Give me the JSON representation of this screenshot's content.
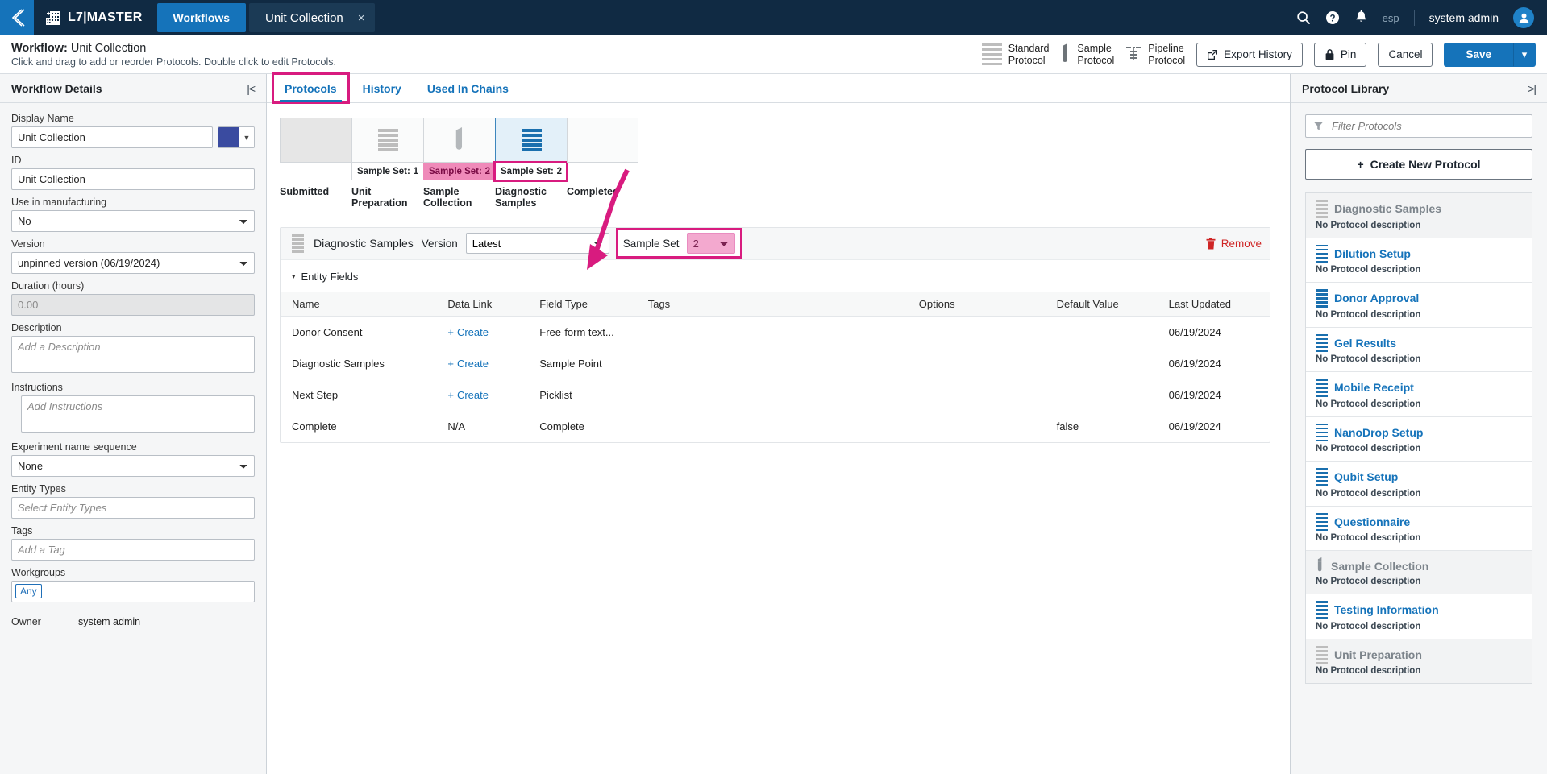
{
  "topnav": {
    "back_icon": "chevron-left-icon",
    "brand_icon": "building-icon",
    "brand": "L7|MASTER",
    "workflows_tab": "Workflows",
    "doc_tab": "Unit Collection",
    "close_glyph": "×",
    "search_icon": "search-icon",
    "help_icon": "help-circle-icon",
    "bell_icon": "bell-icon",
    "lang": "esp",
    "user": "system admin",
    "avatar_icon": "user-avatar-icon",
    "accent": "#1573ba",
    "bg": "#102a43"
  },
  "pagehead": {
    "title_prefix": "Workflow:",
    "title_value": "Unit Collection",
    "subtitle": "Click and drag to add or reorder Protocols. Double click to edit Protocols.",
    "protocol_types": [
      {
        "icon": "standard-protocol-icon",
        "line1": "Standard",
        "line2": "Protocol"
      },
      {
        "icon": "sample-protocol-icon",
        "line1": "Sample",
        "line2": "Protocol"
      },
      {
        "icon": "pipeline-protocol-icon",
        "line1": "Pipeline",
        "line2": "Protocol"
      }
    ],
    "export_history": "Export History",
    "pin": "Pin",
    "cancel": "Cancel",
    "save": "Save",
    "save_caret": "▾"
  },
  "left": {
    "header": "Workflow Details",
    "collapse_icon": "collapse-left-icon",
    "display_name_label": "Display Name",
    "display_name_value": "Unit Collection",
    "color_value": "#3a4ba0",
    "id_label": "ID",
    "id_value": "Unit Collection",
    "manufacturing_label": "Use in manufacturing",
    "manufacturing_value": "No",
    "version_label": "Version",
    "version_value": "unpinned version (06/19/2024)",
    "duration_label": "Duration (hours)",
    "duration_value": "0.00",
    "description_label": "Description",
    "description_placeholder": "Add a Description",
    "instructions_label": "Instructions",
    "instructions_placeholder": "Add Instructions",
    "experiment_seq_label": "Experiment name sequence",
    "experiment_seq_value": "None",
    "entity_types_label": "Entity Types",
    "entity_types_placeholder": "Select Entity Types",
    "tags_label": "Tags",
    "tags_placeholder": "Add a Tag",
    "workgroups_label": "Workgroups",
    "workgroups_chip": "Any",
    "owner_label": "Owner",
    "owner_value": "system admin"
  },
  "center": {
    "tabs": [
      {
        "label": "Protocols",
        "active": true,
        "highlighted": true
      },
      {
        "label": "History",
        "active": false,
        "highlighted": false
      },
      {
        "label": "Used In Chains",
        "active": false,
        "highlighted": false
      }
    ],
    "steps": [
      {
        "name": "Submitted",
        "icon": "none",
        "sampleset_label": "",
        "sampleset_value": "",
        "state": "start"
      },
      {
        "name": "Unit Preparation",
        "icon": "standard-protocol-icon",
        "sampleset_label": "Sample Set:",
        "sampleset_value": "1",
        "state": "normal"
      },
      {
        "name": "Sample Collection",
        "icon": "sample-protocol-icon",
        "sampleset_label": "Sample Set:",
        "sampleset_value": "2",
        "state": "pink"
      },
      {
        "name": "Diagnostic Samples",
        "icon": "standard-protocol-icon",
        "sampleset_label": "Sample Set:",
        "sampleset_value": "2",
        "state": "selected"
      },
      {
        "name": "Completed",
        "icon": "none",
        "sampleset_label": "",
        "sampleset_value": "",
        "state": "end"
      }
    ],
    "detail": {
      "icon": "standard-protocol-icon",
      "protocol_name": "Diagnostic Samples",
      "version_label": "Version",
      "version_value": "Latest",
      "sampleset_label": "Sample Set",
      "sampleset_value": "2",
      "remove_icon": "trash-icon",
      "remove_label": "Remove"
    },
    "entity_fields": {
      "section_title": "Entity Fields",
      "caret": "▾",
      "columns": [
        "Name",
        "Data Link",
        "Field Type",
        "Tags",
        "Options",
        "Default Value",
        "Last Updated"
      ],
      "rows": [
        {
          "name": "Donor Consent",
          "data_link": "Create",
          "link_type": "create",
          "field_type": "Free-form text...",
          "tags": "",
          "options": "",
          "default_value": "",
          "last_updated": "06/19/2024"
        },
        {
          "name": "Diagnostic Samples",
          "data_link": "Create",
          "link_type": "create",
          "field_type": "Sample Point",
          "tags": "",
          "options": "",
          "default_value": "",
          "last_updated": "06/19/2024"
        },
        {
          "name": "Next Step",
          "data_link": "Create",
          "link_type": "create",
          "field_type": "Picklist",
          "tags": "",
          "options": "",
          "default_value": "",
          "last_updated": "06/19/2024"
        },
        {
          "name": "Complete",
          "data_link": "N/A",
          "link_type": "na",
          "field_type": "Complete",
          "tags": "",
          "options": "",
          "default_value": "false",
          "last_updated": "06/19/2024"
        }
      ]
    }
  },
  "right": {
    "header": "Protocol Library",
    "collapse_icon": "collapse-right-icon",
    "filter_icon": "filter-icon",
    "filter_placeholder": "Filter Protocols",
    "create_label": "Create New Protocol",
    "create_plus": "+",
    "protocols": [
      {
        "name": "Diagnostic Samples",
        "desc": "No Protocol description",
        "icon": "standard-protocol-icon",
        "disabled": true
      },
      {
        "name": "Dilution Setup",
        "desc": "No Protocol description",
        "icon": "standard-protocol-icon",
        "disabled": false
      },
      {
        "name": "Donor Approval",
        "desc": "No Protocol description",
        "icon": "standard-protocol-icon",
        "disabled": false
      },
      {
        "name": "Gel Results",
        "desc": "No Protocol description",
        "icon": "standard-protocol-icon",
        "disabled": false
      },
      {
        "name": "Mobile Receipt",
        "desc": "No Protocol description",
        "icon": "standard-protocol-icon",
        "disabled": false
      },
      {
        "name": "NanoDrop Setup",
        "desc": "No Protocol description",
        "icon": "standard-protocol-icon",
        "disabled": false
      },
      {
        "name": "Qubit Setup",
        "desc": "No Protocol description",
        "icon": "standard-protocol-icon",
        "disabled": false
      },
      {
        "name": "Questionnaire",
        "desc": "No Protocol description",
        "icon": "standard-protocol-icon",
        "disabled": false
      },
      {
        "name": "Sample Collection",
        "desc": "No Protocol description",
        "icon": "sample-protocol-icon",
        "disabled": true
      },
      {
        "name": "Testing Information",
        "desc": "No Protocol description",
        "icon": "standard-protocol-icon",
        "disabled": false
      },
      {
        "name": "Unit Preparation",
        "desc": "No Protocol description",
        "icon": "standard-protocol-icon",
        "disabled": true
      }
    ]
  },
  "annotations": {
    "highlight_color": "#d81b7f"
  }
}
